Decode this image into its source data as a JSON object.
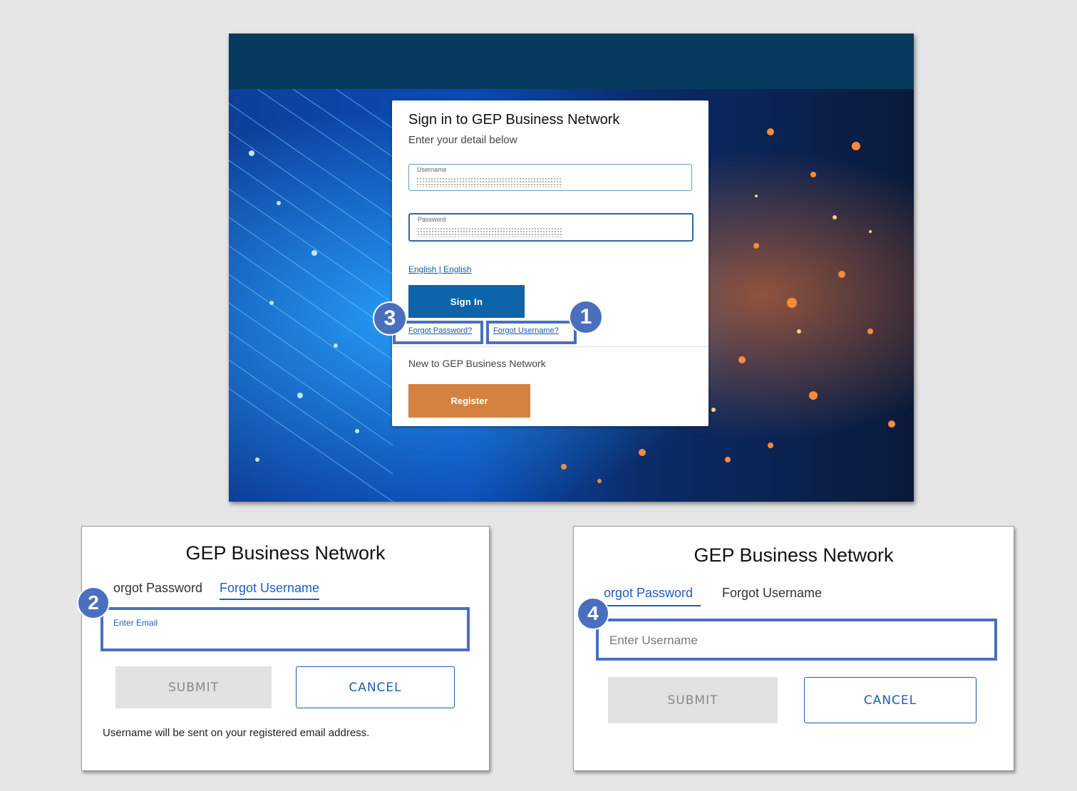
{
  "login": {
    "title": "Sign in to GEP Business Network",
    "subtitle": "Enter your detail below",
    "username_label": "Username",
    "password_label": "Password",
    "language_link": "English | English",
    "sign_in_label": "Sign In",
    "forgot_password_link": "Forgot Password?",
    "forgot_username_link": "Forgot Username?",
    "new_user_text": "New to GEP Business Network",
    "register_label": "Register"
  },
  "callouts": {
    "one": "1",
    "two": "2",
    "three": "3",
    "four": "4",
    "color": "#4a6fbf"
  },
  "forgot_username_dialog": {
    "title": "GEP Business Network",
    "tab_forgot_password": "orgot Password",
    "tab_forgot_username": "Forgot Username",
    "email_label": "Enter Email",
    "submit_label": "SUBMIT",
    "cancel_label": "CANCEL",
    "note": "Username will be sent on your registered email address."
  },
  "forgot_password_dialog": {
    "title": "GEP Business Network",
    "tab_forgot_password": "orgot Password",
    "tab_forgot_username": "Forgot Username",
    "username_placeholder": "Enter Username",
    "submit_label": "SUBMIT",
    "cancel_label": "CANCEL"
  },
  "colors": {
    "header": "#073a5f",
    "primary_button": "#0e64a8",
    "register_button": "#d4823f",
    "link": "#1a5aa0",
    "tab_active": "#1e5fbf"
  }
}
